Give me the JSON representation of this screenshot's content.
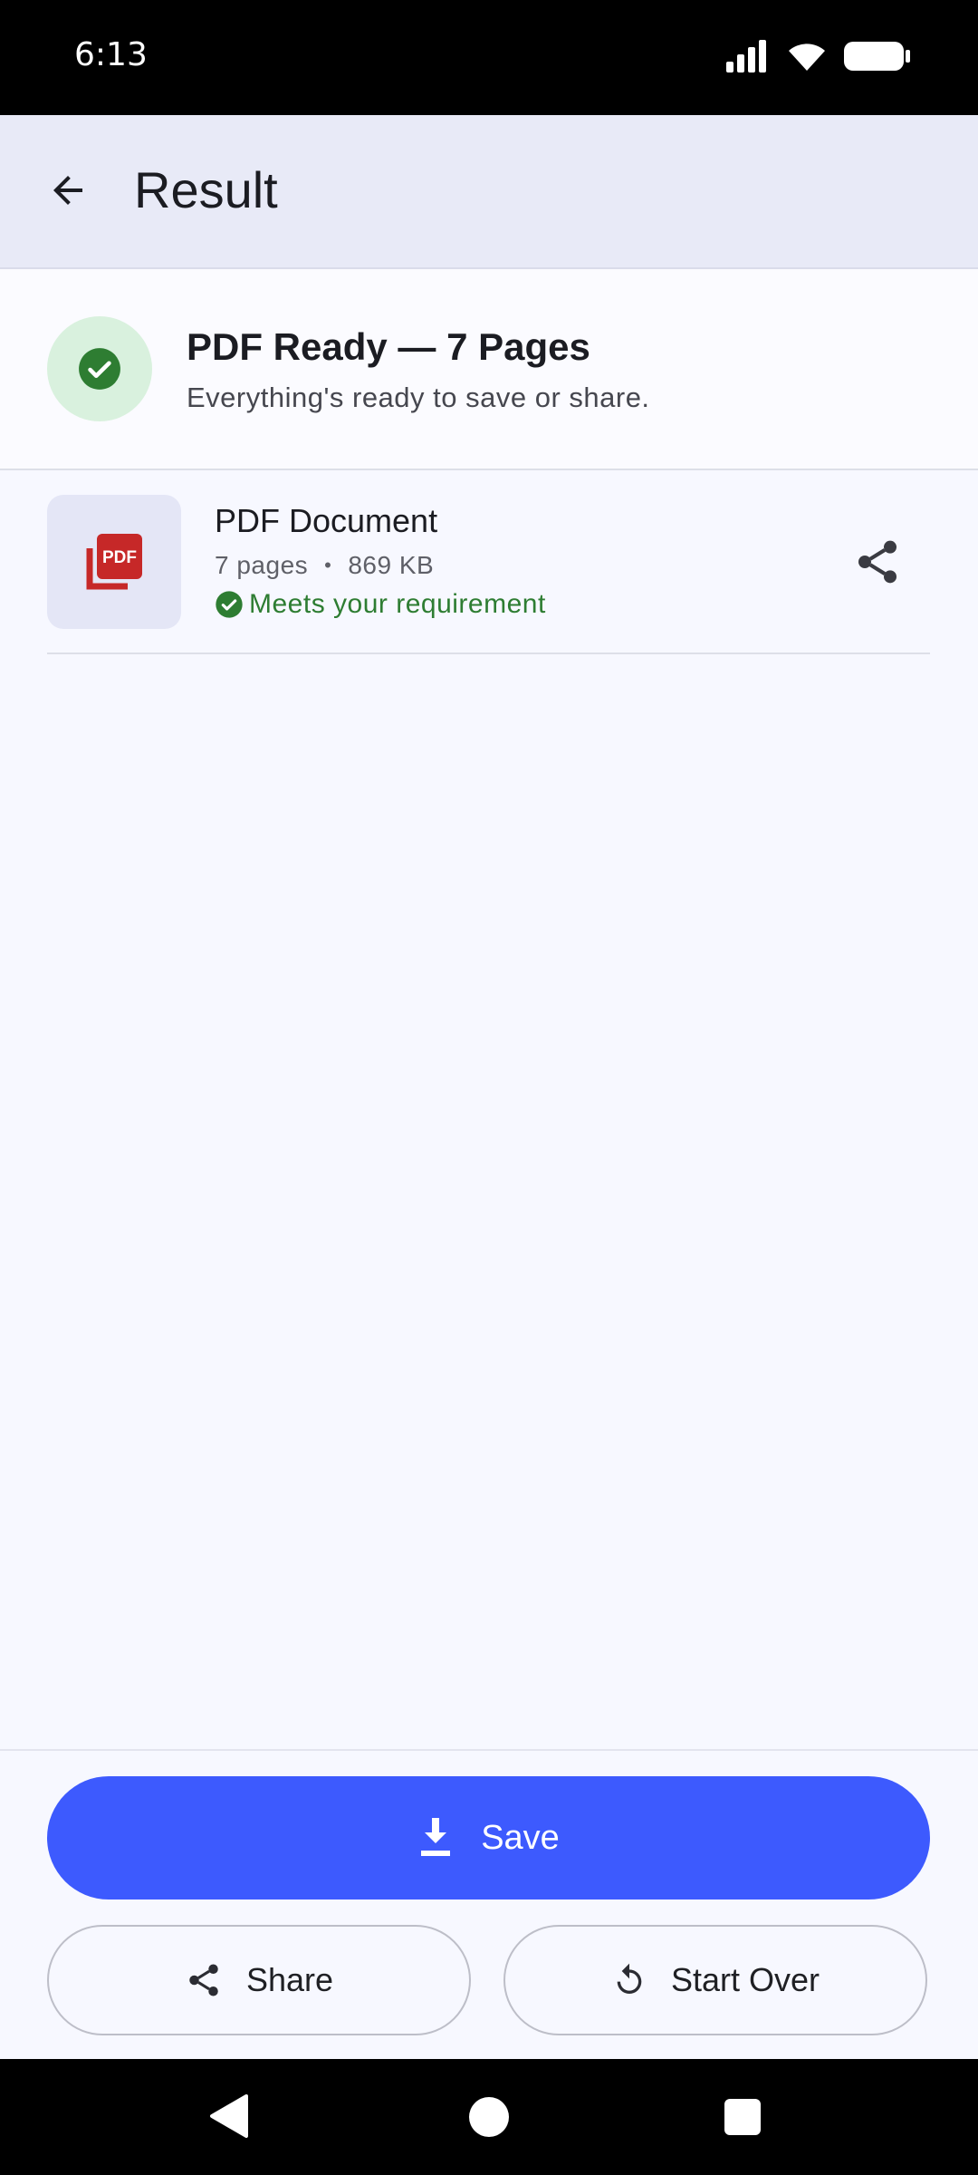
{
  "status_bar": {
    "time": "6:13"
  },
  "app_bar": {
    "title": "Result"
  },
  "ready": {
    "title": "PDF Ready — 7 Pages",
    "subtitle": "Everything's ready to save or share."
  },
  "file": {
    "thumb_label": "PDF",
    "name": "PDF Document",
    "pages": "7 pages",
    "separator": "•",
    "size": "869 KB",
    "requirement": "Meets your requirement"
  },
  "actions": {
    "save_label": "Save",
    "share_label": "Share",
    "start_over_label": "Start Over"
  },
  "colors": {
    "accent": "#3d5afe",
    "success": "#2e7d32",
    "pdf_red": "#c62828"
  }
}
